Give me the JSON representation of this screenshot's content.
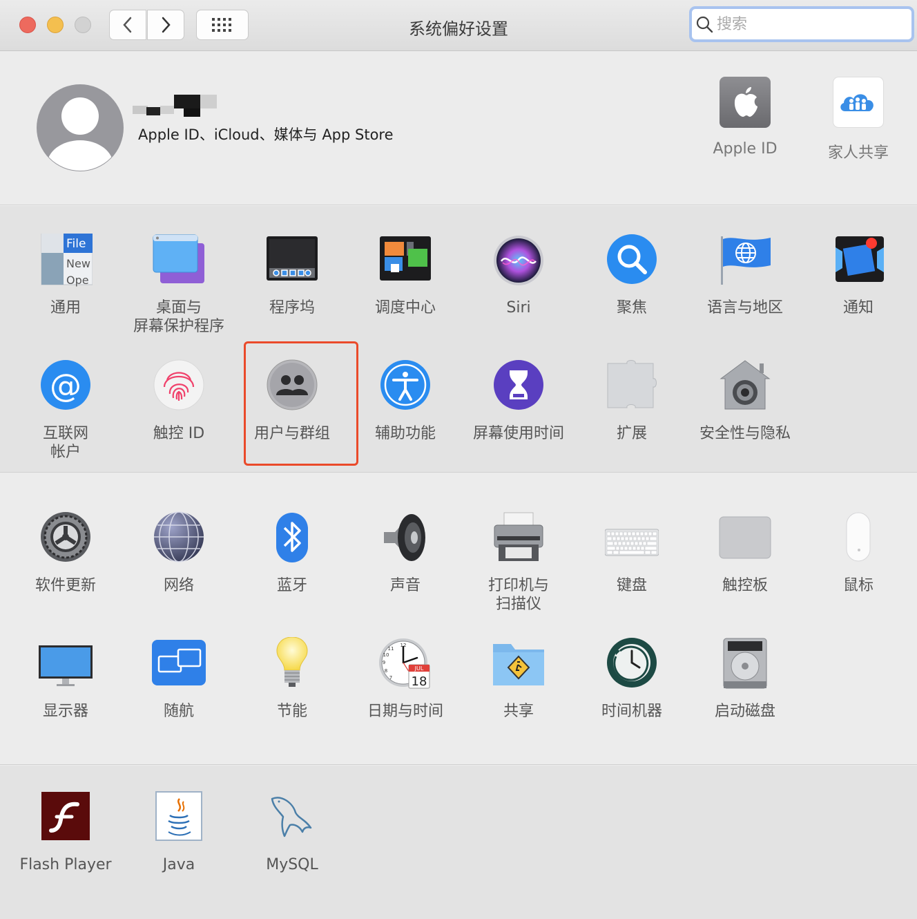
{
  "window": {
    "title": "系统偏好设置",
    "search_placeholder": "搜索"
  },
  "account": {
    "subtitle": "Apple ID、iCloud、媒体与 App Store",
    "apple_id_label": "Apple ID",
    "family_label": "家人共享"
  },
  "section1": {
    "row1": [
      {
        "label": "通用",
        "icon": "general-icon"
      },
      {
        "label": "桌面与\n屏幕保护程序",
        "icon": "desktop-screensaver-icon"
      },
      {
        "label": "程序坞",
        "icon": "dock-icon"
      },
      {
        "label": "调度中心",
        "icon": "mission-control-icon"
      },
      {
        "label": "Siri",
        "icon": "siri-icon"
      },
      {
        "label": "聚焦",
        "icon": "spotlight-icon"
      },
      {
        "label": "语言与地区",
        "icon": "language-region-icon"
      },
      {
        "label": "通知",
        "icon": "notifications-icon"
      }
    ],
    "row2": [
      {
        "label": "互联网\n帐户",
        "icon": "internet-accounts-icon"
      },
      {
        "label": "触控 ID",
        "icon": "touch-id-icon"
      },
      {
        "label": "用户与群组",
        "icon": "users-groups-icon"
      },
      {
        "label": "辅助功能",
        "icon": "accessibility-icon"
      },
      {
        "label": "屏幕使用时间",
        "icon": "screen-time-icon"
      },
      {
        "label": "扩展",
        "icon": "extensions-icon"
      },
      {
        "label": "安全性与隐私",
        "icon": "security-privacy-icon"
      }
    ]
  },
  "section2": {
    "row1": [
      {
        "label": "软件更新",
        "icon": "software-update-icon"
      },
      {
        "label": "网络",
        "icon": "network-icon"
      },
      {
        "label": "蓝牙",
        "icon": "bluetooth-icon"
      },
      {
        "label": "声音",
        "icon": "sound-icon"
      },
      {
        "label": "打印机与\n扫描仪",
        "icon": "printers-scanners-icon"
      },
      {
        "label": "键盘",
        "icon": "keyboard-icon"
      },
      {
        "label": "触控板",
        "icon": "trackpad-icon"
      },
      {
        "label": "鼠标",
        "icon": "mouse-icon"
      }
    ],
    "row2": [
      {
        "label": "显示器",
        "icon": "displays-icon"
      },
      {
        "label": "随航",
        "icon": "sidecar-icon"
      },
      {
        "label": "节能",
        "icon": "energy-saver-icon"
      },
      {
        "label": "日期与时间",
        "icon": "date-time-icon"
      },
      {
        "label": "共享",
        "icon": "sharing-icon"
      },
      {
        "label": "时间机器",
        "icon": "time-machine-icon"
      },
      {
        "label": "启动磁盘",
        "icon": "startup-disk-icon"
      }
    ]
  },
  "section3": {
    "row1": [
      {
        "label": "Flash Player",
        "icon": "flash-player-icon"
      },
      {
        "label": "Java",
        "icon": "java-icon"
      },
      {
        "label": "MySQL",
        "icon": "mysql-icon"
      }
    ]
  },
  "icon_texts": {
    "general_file": "File",
    "general_new": "New",
    "general_open": "Ope",
    "calendar_month": "JUL",
    "calendar_day": "18",
    "clock_12": "12",
    "clock_9": "9",
    "clock_11": "11",
    "clock_10": "10",
    "clock_8": "8",
    "clock_7": "7"
  },
  "colors": {
    "highlight": "#ea4a2a",
    "search_ring": "#a8c3ef"
  }
}
